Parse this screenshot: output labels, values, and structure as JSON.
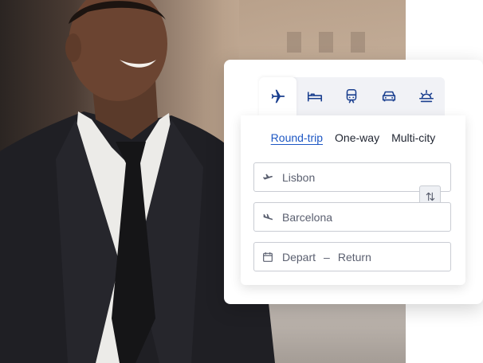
{
  "tabs": [
    {
      "icon": "flight-icon",
      "active": true
    },
    {
      "icon": "hotel-bed-icon",
      "active": false
    },
    {
      "icon": "train-icon",
      "active": false
    },
    {
      "icon": "car-icon",
      "active": false
    },
    {
      "icon": "sunrise-vacation-icon",
      "active": false
    }
  ],
  "trip_types": {
    "round_trip": "Round-trip",
    "one_way": "One-way",
    "multi_city": "Multi-city",
    "selected": "Round-trip"
  },
  "search": {
    "origin": "Lisbon",
    "destination": "Barcelona",
    "depart": "Depart",
    "dash": "–",
    "return": "Return"
  },
  "colors": {
    "accent": "#1d57c4",
    "icon": "#1a3f8f",
    "muted_icon": "#5b6070"
  }
}
